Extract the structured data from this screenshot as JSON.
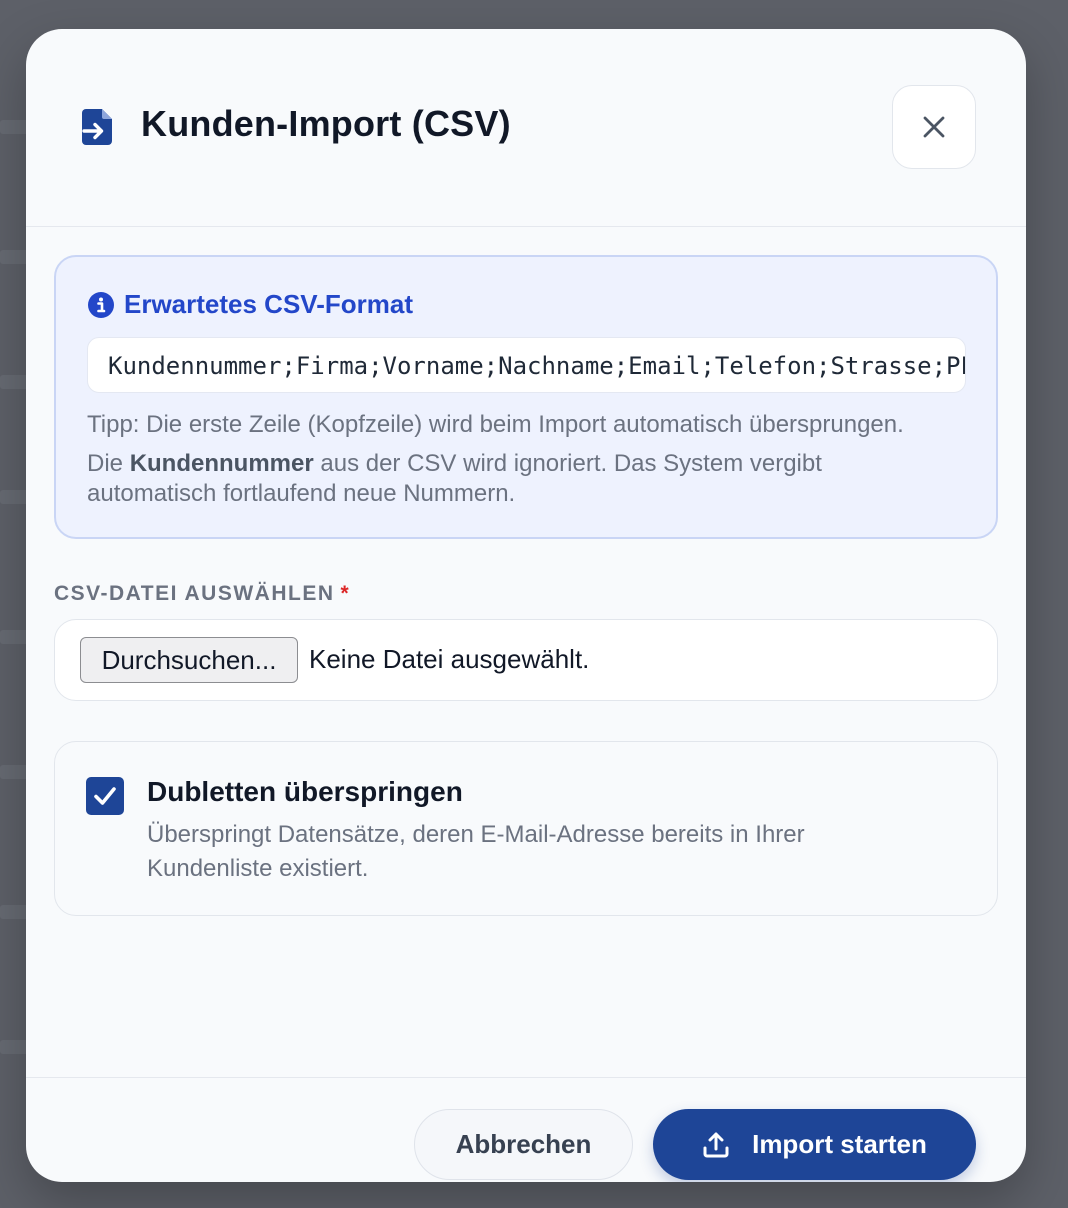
{
  "dialog": {
    "title": "Kunden-Import (CSV)",
    "icon": "file-import-icon",
    "close_icon": "close-icon"
  },
  "info": {
    "title": "Erwartetes CSV-Format",
    "icon": "info-icon",
    "format": "Kundennummer;Firma;Vorname;Nachname;Email;Telefon;Strasse;PLZ;Ort",
    "tip": "Tipp: Die erste Zeile (Kopfzeile) wird beim Import automatisch übersprungen.",
    "note_prefix": "Die ",
    "note_bold": "Kundennummer",
    "note_suffix": " aus der CSV wird ignoriert. Das System vergibt automatisch fortlaufend neue Nummern."
  },
  "file": {
    "label": "CSV-DATEI AUSWÄHLEN",
    "required_mark": "*",
    "browse_label": "Durchsuchen...",
    "status": "Keine Datei ausgewählt."
  },
  "duplicates": {
    "checked": true,
    "title": "Dubletten überspringen",
    "description": "Überspringt Datensätze, deren E-Mail-Adresse bereits in Ihrer Kundenliste existiert."
  },
  "footer": {
    "cancel_label": "Abbrechen",
    "import_label": "Import starten",
    "import_icon": "upload-icon"
  },
  "colors": {
    "primary": "#1e4597",
    "info_accent": "#2347c9",
    "info_bg": "#eef2fe",
    "required": "#dc2626"
  }
}
